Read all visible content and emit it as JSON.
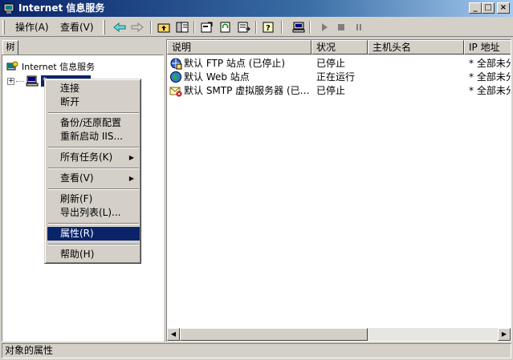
{
  "window": {
    "title": "Internet 信息服务"
  },
  "menu": {
    "action": "操作(A)",
    "view": "查看(V)"
  },
  "tree": {
    "tab_label": "树",
    "root_label": "Internet 信息服务",
    "selected_node": "*"
  },
  "list": {
    "columns": [
      "说明",
      "状况",
      "主机头名",
      "IP 地址"
    ],
    "rows": [
      {
        "icon": "ftp-site-icon",
        "name": "默认 FTP 站点 (已停止)",
        "status": "已停止",
        "host": "",
        "ip": "* 全部未分"
      },
      {
        "icon": "web-site-icon",
        "name": "默认 Web 站点",
        "status": "正在运行",
        "host": "",
        "ip": "* 全部未分"
      },
      {
        "icon": "smtp-server-icon",
        "name": "默认 SMTP 虚拟服务器 (已…",
        "status": "已停止",
        "host": "",
        "ip": "* 全部未分"
      }
    ]
  },
  "context_menu": {
    "items": [
      {
        "label": "连接"
      },
      {
        "label": "断开"
      },
      {
        "label": "备份/还原配置"
      },
      {
        "label": "重新启动 IIS..."
      },
      {
        "label": "所有任务(K)",
        "submenu": true
      },
      {
        "label": "查看(V)",
        "submenu": true
      },
      {
        "label": "刷新(F)"
      },
      {
        "label": "导出列表(L)..."
      },
      {
        "label": "属性(R)",
        "highlighted": true
      },
      {
        "label": "帮助(H)"
      }
    ]
  },
  "status_bar": {
    "text": "对象的属性"
  },
  "colors": {
    "selection": "#0a246a",
    "face": "#d4d0c8"
  }
}
